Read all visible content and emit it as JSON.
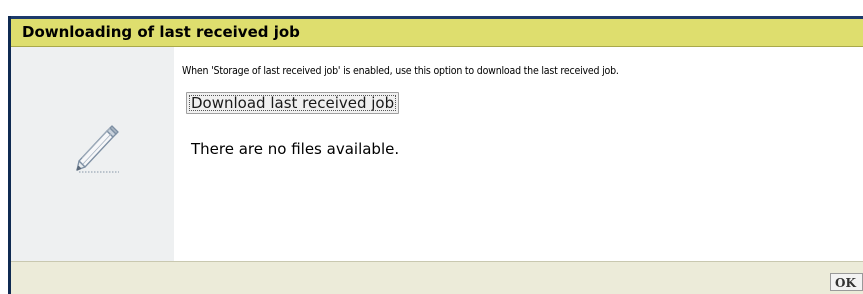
{
  "dialog": {
    "title": "Downloading of last received job",
    "description": "When 'Storage of last received job' is enabled, use this option to download the last received job.",
    "download_button_label": "Download last received job",
    "status_text": "There are no files available.",
    "ok_label": "OK",
    "icon": "pencil-icon"
  },
  "colors": {
    "title_bar": "#dede6e",
    "title_border": "#1c3a6b",
    "icon_pane": "#eef0f1",
    "footer": "#ecebd9"
  }
}
